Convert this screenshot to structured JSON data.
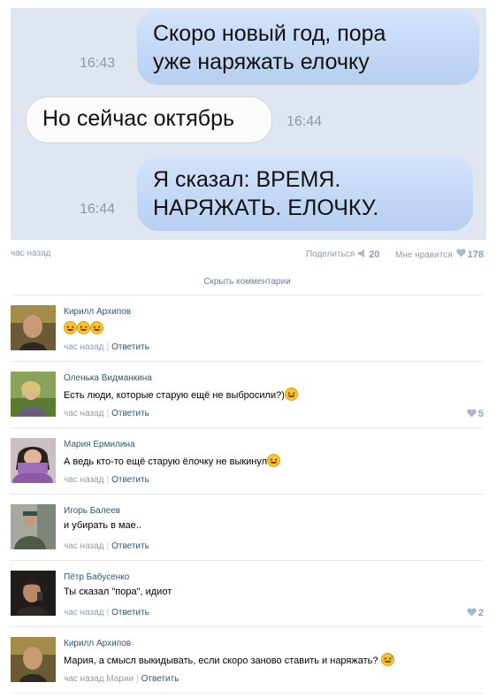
{
  "chat": {
    "messages": [
      {
        "lines": [
          "Скоро новый год, пора",
          "уже наряжать елочку"
        ],
        "time": "16:43"
      },
      {
        "lines": [
          "Но сейчас октябрь"
        ],
        "time": "16:44"
      },
      {
        "lines": [
          "Я сказал: ВРЕМЯ.",
          "НАРЯЖАТЬ. ЕЛОЧКУ."
        ],
        "time": "16:44"
      }
    ]
  },
  "post": {
    "time_ago": "час назад",
    "share_label": "Поделиться",
    "share_count": "20",
    "like_label": "Мне нравится",
    "like_count": "178",
    "hide_comments": "Скрыть комментарии"
  },
  "comments": [
    {
      "name": "Кирилл Архипов",
      "text": "",
      "time": "час назад",
      "reply_to": "",
      "reply": "Ответить",
      "likes": ""
    },
    {
      "name": "Оленька Видманкина",
      "text": "Есть люди, которые старую ещё не выбросили?)",
      "time": "час назад",
      "reply_to": "",
      "reply": "Ответить",
      "likes": "5"
    },
    {
      "name": "Мария Ермилина",
      "text": "А ведь кто-то ещё старую ёлочку не выкинул",
      "time": "час назад",
      "reply_to": "",
      "reply": "Ответить",
      "likes": ""
    },
    {
      "name": "Игорь Балеев",
      "text": "и убирать в мае..",
      "time": "час назад",
      "reply_to": "",
      "reply": "Ответить",
      "likes": ""
    },
    {
      "name": "Пётр Бабусенко",
      "text": "Ты сказал \"пора\", идиот",
      "time": "час назад",
      "reply_to": "",
      "reply": "Ответить",
      "likes": "2"
    },
    {
      "name": "Кирилл Архипов",
      "text": "Мария, а смысл выкидывать, если скоро заново ставить и наряжать?",
      "time": "час назад",
      "reply_to": "Марии",
      "reply": "Ответить",
      "likes": ""
    }
  ],
  "colors": {
    "link": "#2b587a",
    "muted": "#8f9aa6",
    "chat_bg": "#dfe5f1",
    "bubble_out": "#c4d8f6"
  }
}
